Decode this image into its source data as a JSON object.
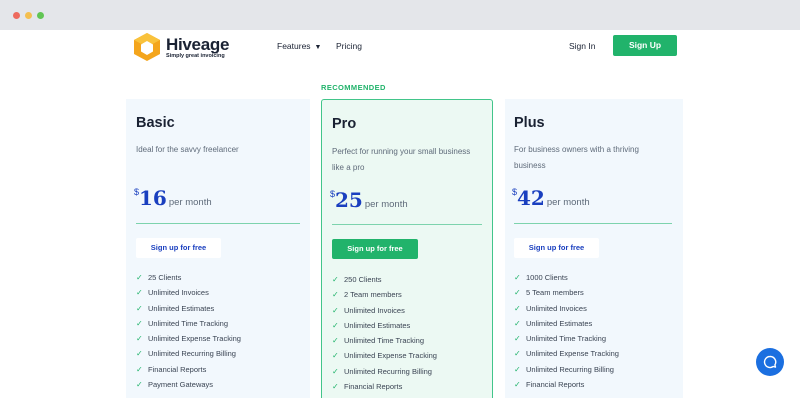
{
  "nav": {
    "brand": "Hiveage",
    "tagline": "Simply great invoicing",
    "features": "Features",
    "pricing": "Pricing",
    "sign_in": "Sign In",
    "sign_up": "Sign Up"
  },
  "recommended_label": "RECOMMENDED",
  "plans": [
    {
      "name": "Basic",
      "description": "Ideal for the savvy freelancer",
      "currency": "$",
      "price": "16",
      "period": "per month",
      "cta": "Sign up for free",
      "features": [
        "25 Clients",
        "Unlimited Invoices",
        "Unlimited Estimates",
        "Unlimited Time Tracking",
        "Unlimited Expense Tracking",
        "Unlimited Recurring Billing",
        "Financial Reports",
        "Payment Gateways"
      ]
    },
    {
      "name": "Pro",
      "description": "Perfect for running your small business like a pro",
      "currency": "$",
      "price": "25",
      "period": "per month",
      "cta": "Sign up for free",
      "features": [
        "250 Clients",
        "2 Team members",
        "Unlimited Invoices",
        "Unlimited Estimates",
        "Unlimited Time Tracking",
        "Unlimited Expense Tracking",
        "Unlimited Recurring Billing",
        "Financial Reports"
      ]
    },
    {
      "name": "Plus",
      "description": "For business owners with a thriving business",
      "currency": "$",
      "price": "42",
      "period": "per month",
      "cta": "Sign up for free",
      "features": [
        "1000 Clients",
        "5 Team members",
        "Unlimited Invoices",
        "Unlimited Estimates",
        "Unlimited Time Tracking",
        "Unlimited Expense Tracking",
        "Unlimited Recurring Billing",
        "Financial Reports"
      ]
    }
  ],
  "icons": {
    "logo": "hexagon-logo-icon",
    "check": "check-icon",
    "chat": "chat-bubble-icon",
    "chevron": "chevron-down-icon"
  },
  "colors": {
    "accent_green": "#21b36b",
    "price_blue": "#1a3fbf",
    "chat_blue": "#1b6fe0"
  }
}
